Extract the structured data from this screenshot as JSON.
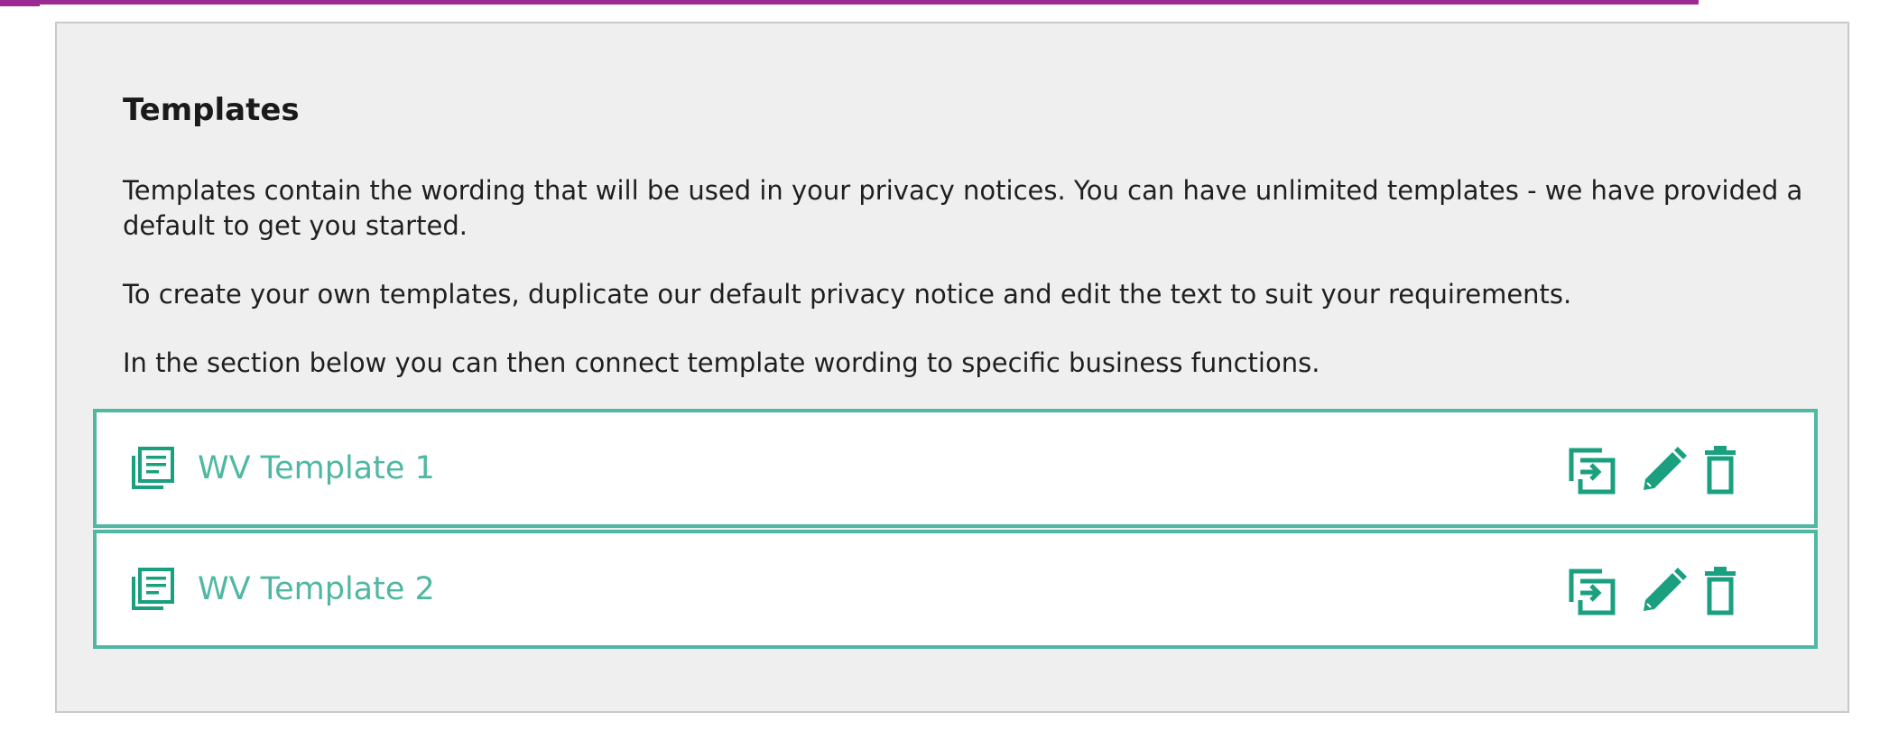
{
  "colors": {
    "accent": "#4fb8a2",
    "icon": "#1aa07f",
    "top_bar": "#9b2a93",
    "panel_bg": "#efefef"
  },
  "section": {
    "title": "Templates",
    "paragraphs": [
      "Templates contain the wording that will be used in your privacy notices. You can have unlimited templates - we have provided a default to get you started.",
      "To create your own templates, duplicate our default privacy notice and edit the text to suit your requirements.",
      "In the section below you can then connect template wording to specific business functions."
    ]
  },
  "templates": [
    {
      "name": "WV Template 1",
      "icon": "document-list-icon"
    },
    {
      "name": "WV Template 2",
      "icon": "document-list-icon"
    }
  ],
  "actions": {
    "duplicate_icon": "duplicate-icon",
    "edit_icon": "pencil-icon",
    "delete_icon": "trash-icon"
  }
}
